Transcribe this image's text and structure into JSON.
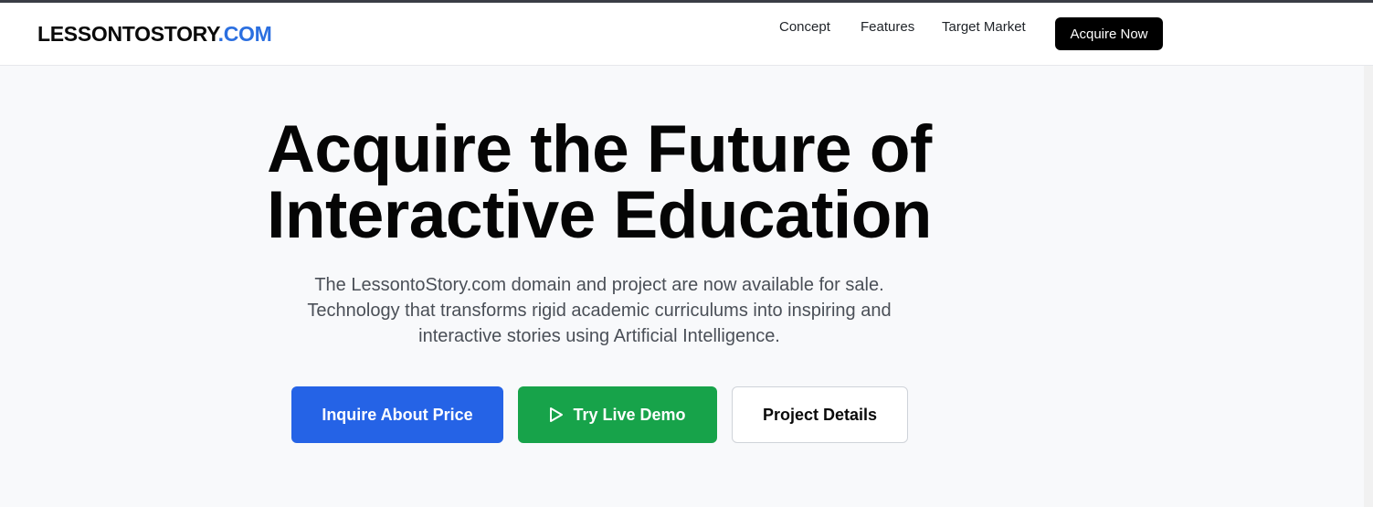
{
  "header": {
    "logo_main": "LESSONTOSTORY",
    "logo_accent": ".COM",
    "nav": {
      "concept": "Concept",
      "features": "Features",
      "target_market": "Target Market"
    },
    "cta_label": "Acquire Now"
  },
  "hero": {
    "title_line1": "Acquire the Future of",
    "title_line2": "Interactive Education",
    "subtitle_line1": "The LessontoStory.com domain and project are now available for sale.",
    "subtitle_line2": "Technology that transforms rigid academic curriculums into inspiring and",
    "subtitle_line3": "interactive stories using Artificial Intelligence."
  },
  "actions": {
    "inquire_label": "Inquire About Price",
    "demo_label": "Try Live Demo",
    "details_label": "Project Details",
    "demo_icon": "play-icon"
  },
  "colors": {
    "accent_blue": "#2563e6",
    "accent_green": "#17a34a",
    "logo_accent": "#2b6fe0"
  }
}
